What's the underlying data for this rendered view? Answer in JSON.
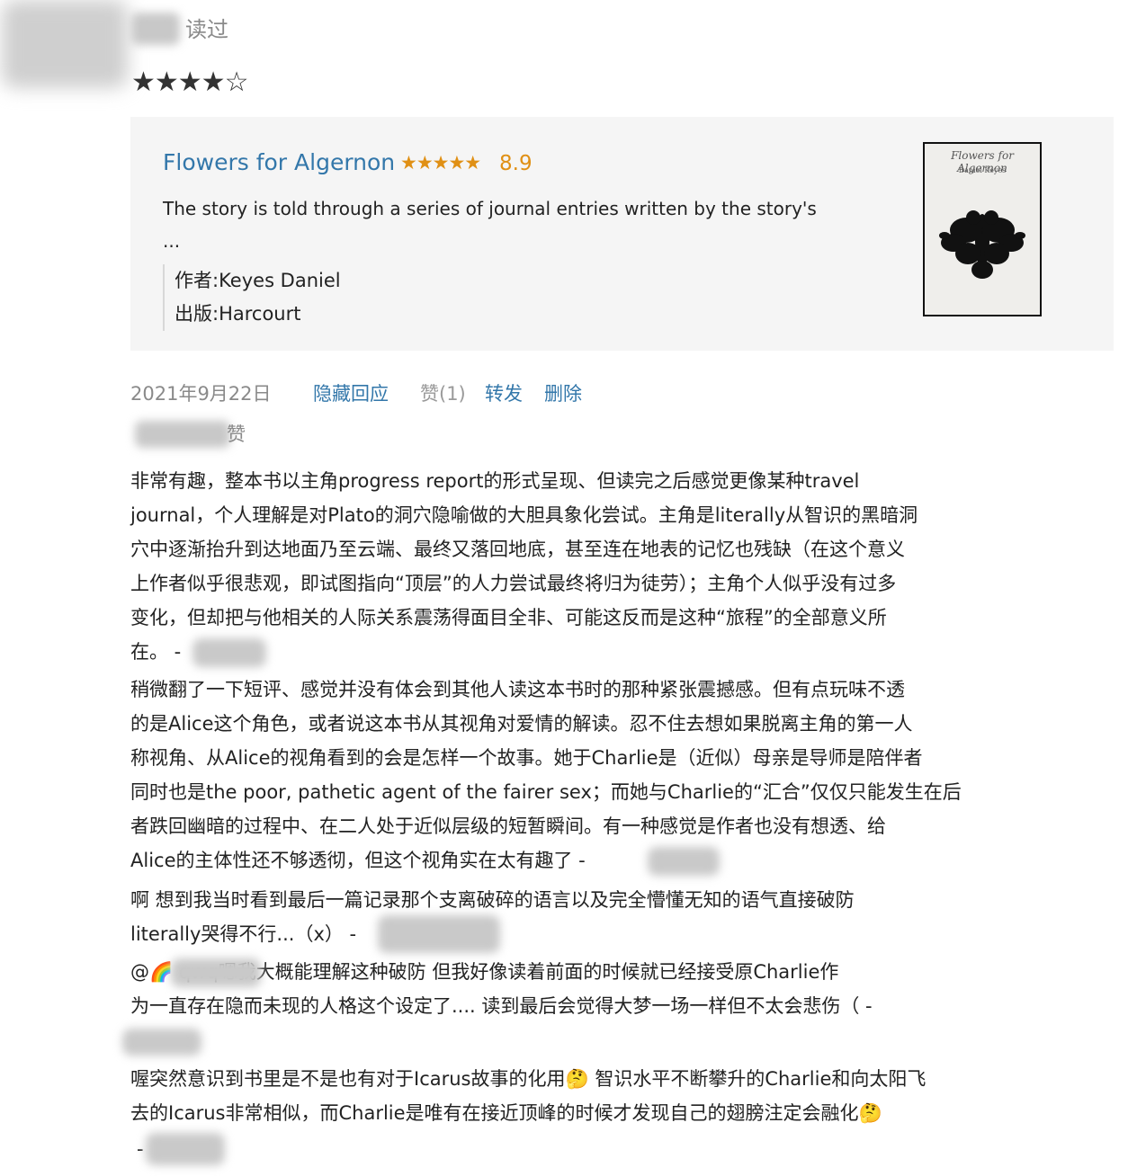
{
  "header": {
    "read_label": "读过",
    "rating": "★★★★☆"
  },
  "book": {
    "title": "Flowers for Algernon",
    "stars": "★★★★★",
    "score": "8.9",
    "description": "The story is told through a series of journal entries written by the story's",
    "ellipsis": "...",
    "author_line": "作者:Keyes Daniel",
    "publisher_line": "出版:Harcourt",
    "cover": {
      "title": "Flowers for Algernon",
      "author": "Daniel Keyes"
    }
  },
  "actions": {
    "date": "2021年9月22日",
    "hide_replies": "隐藏回应",
    "like": "赞(1)",
    "share": "转发",
    "delete": "删除"
  },
  "likers_label": "赞",
  "comment_lines": [
    "非常有趣，整本书以主角progress report的形式呈现、但读完之后感觉更像某种travel",
    "journal，个人理解是对Plato的洞穴隐喻做的大胆具象化尝试。主角是literally从智识的黑暗洞",
    "穴中逐渐抬升到达地面乃至云端、最终又落回地底，甚至连在地表的记忆也残缺（在这个意义",
    "上作者似乎很悲观，即试图指向“顶层”的人力尝试最终将归为徒劳）；主角个人似乎没有过多",
    "变化，但却把与他相关的人际关系震荡得面目全非、可能这反而是这种“旅程”的全部意义所",
    "在。 -",
    "稍微翻了一下短评、感觉并没有体会到其他人读这本书时的那种紧张震撼感。但有点玩味不透",
    "的是Alice这个角色，或者说这本书从其视角对爱情的解读。忍不住去想如果脱离主角的第一人",
    "称视角、从Alice的视角看到的会是怎样一个故事。她于Charlie是（近似）母亲是导师是陪伴者",
    "同时也是the poor, pathetic agent of the fairer sex；而她与Charlie的“汇合”仅仅只能发生在后",
    "者跌回幽暗的过程中、在二人处于近似层级的短暂瞬间。有一种感觉是作者也没有想透、给",
    "Alice的主体性还不够透彻，但这个视角实在太有趣了 -",
    "啊 想到我当时看到最后一篇记录那个支离破碎的语言以及完全懵懂无知的语气直接破防",
    "literally哭得不行...（x） -",
    "@🌈                     qwq嗯我大概能理解这种破防 但我好像读着前面的时候就已经接受原Charlie作",
    "为一直存在隐而未现的人格这个设定了.... 读到最后会觉得大梦一场一样但不太会悲伤（ -",
    "喔突然意识到书里是不是也有对于Icarus故事的化用🤔 智识水平不断攀升的Charlie和向太阳飞",
    "去的Icarus非常相似，而Charlie是唯有在接近顶峰的时候才发现自己的翅膀注定会融化🤔",
    "-"
  ]
}
